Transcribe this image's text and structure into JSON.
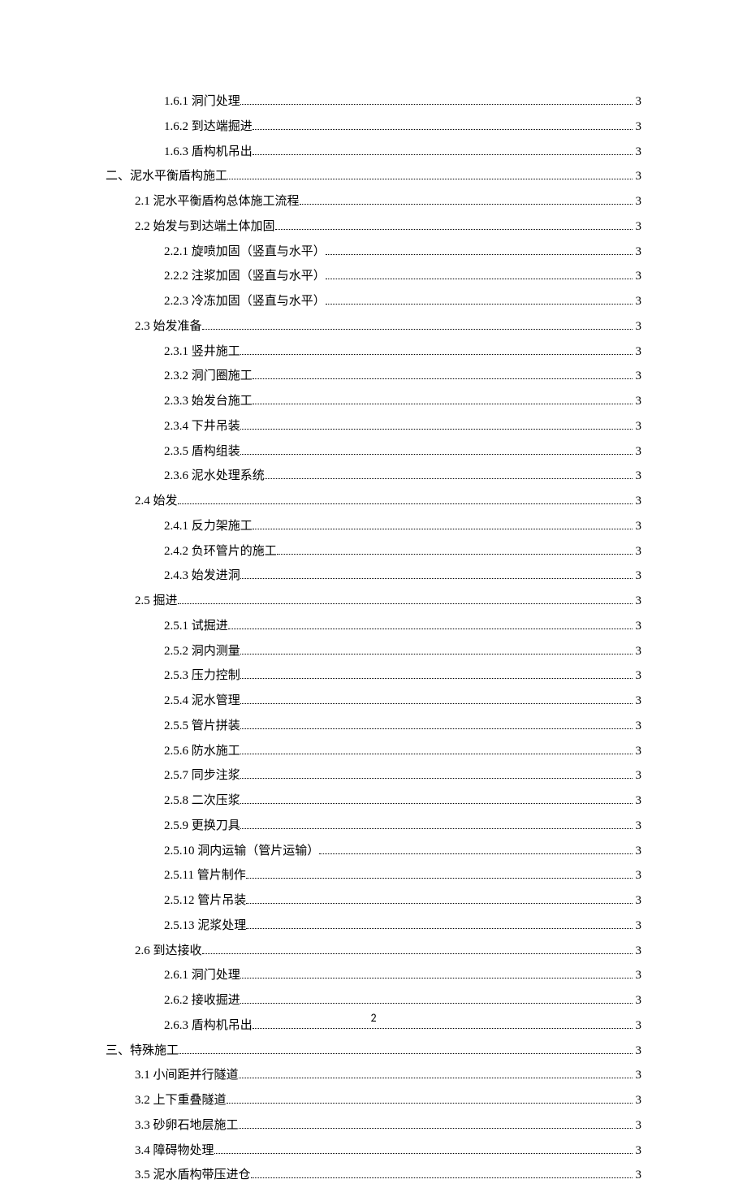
{
  "toc": [
    {
      "level": 3,
      "label": "1.6.1 洞门处理",
      "page": "3"
    },
    {
      "level": 3,
      "label": "1.6.2 到达端掘进",
      "page": "3"
    },
    {
      "level": 3,
      "label": "1.6.3 盾构机吊出",
      "page": "3"
    },
    {
      "level": 1,
      "label": "二、泥水平衡盾构施工",
      "page": "3"
    },
    {
      "level": 2,
      "label": "2.1 泥水平衡盾构总体施工流程",
      "page": "3"
    },
    {
      "level": 2,
      "label": "2.2 始发与到达端土体加固",
      "page": "3"
    },
    {
      "level": 3,
      "label": "2.2.1 旋喷加固（竖直与水平）",
      "page": "3"
    },
    {
      "level": 3,
      "label": "2.2.2 注浆加固（竖直与水平）",
      "page": "3"
    },
    {
      "level": 3,
      "label": "2.2.3 冷冻加固（竖直与水平）",
      "page": "3"
    },
    {
      "level": 2,
      "label": "2.3 始发准备",
      "page": "3"
    },
    {
      "level": 3,
      "label": "2.3.1 竖井施工",
      "page": "3"
    },
    {
      "level": 3,
      "label": "2.3.2 洞门圈施工",
      "page": "3"
    },
    {
      "level": 3,
      "label": "2.3.3 始发台施工",
      "page": "3"
    },
    {
      "level": 3,
      "label": "2.3.4 下井吊装",
      "page": "3"
    },
    {
      "level": 3,
      "label": "2.3.5 盾构组装",
      "page": "3"
    },
    {
      "level": 3,
      "label": "2.3.6 泥水处理系统",
      "page": "3"
    },
    {
      "level": 2,
      "label": "2.4 始发",
      "page": "3"
    },
    {
      "level": 3,
      "label": "2.4.1 反力架施工",
      "page": "3"
    },
    {
      "level": 3,
      "label": "2.4.2 负环管片的施工",
      "page": "3"
    },
    {
      "level": 3,
      "label": "2.4.3 始发进洞",
      "page": "3"
    },
    {
      "level": 2,
      "label": "2.5 掘进",
      "page": "3"
    },
    {
      "level": 3,
      "label": "2.5.1 试掘进",
      "page": "3"
    },
    {
      "level": 3,
      "label": "2.5.2 洞内测量",
      "page": "3"
    },
    {
      "level": 3,
      "label": "2.5.3 压力控制",
      "page": "3"
    },
    {
      "level": 3,
      "label": "2.5.4 泥水管理",
      "page": "3"
    },
    {
      "level": 3,
      "label": "2.5.5 管片拼装",
      "page": "3"
    },
    {
      "level": 3,
      "label": "2.5.6 防水施工",
      "page": "3"
    },
    {
      "level": 3,
      "label": "2.5.7 同步注浆",
      "page": "3"
    },
    {
      "level": 3,
      "label": "2.5.8 二次压浆",
      "page": "3"
    },
    {
      "level": 3,
      "label": "2.5.9 更换刀具",
      "page": "3"
    },
    {
      "level": 3,
      "label": "2.5.10 洞内运输（管片运输）",
      "page": "3"
    },
    {
      "level": 3,
      "label": "2.5.11 管片制作",
      "page": "3"
    },
    {
      "level": 3,
      "label": "2.5.12 管片吊装",
      "page": "3"
    },
    {
      "level": 3,
      "label": "2.5.13 泥浆处理",
      "page": "3"
    },
    {
      "level": 2,
      "label": "2.6 到达接收",
      "page": "3"
    },
    {
      "level": 3,
      "label": "2.6.1 洞门处理",
      "page": "3"
    },
    {
      "level": 3,
      "label": "2.6.2 接收掘进",
      "page": "3"
    },
    {
      "level": 3,
      "label": "2.6.3 盾构机吊出",
      "page": "3"
    },
    {
      "level": 1,
      "label": "三、特殊施工",
      "page": "3"
    },
    {
      "level": 2,
      "label": "3.1 小间距并行隧道",
      "page": "3"
    },
    {
      "level": 2,
      "label": "3.2 上下重叠隧道",
      "page": "3"
    },
    {
      "level": 2,
      "label": "3.3 砂卵石地层施工",
      "page": "3"
    },
    {
      "level": 2,
      "label": "3.4 障碍物处理",
      "page": "3"
    },
    {
      "level": 2,
      "label": "3.5 泥水盾构带压进仓",
      "page": "3"
    }
  ],
  "footer": {
    "page_number": "2"
  }
}
